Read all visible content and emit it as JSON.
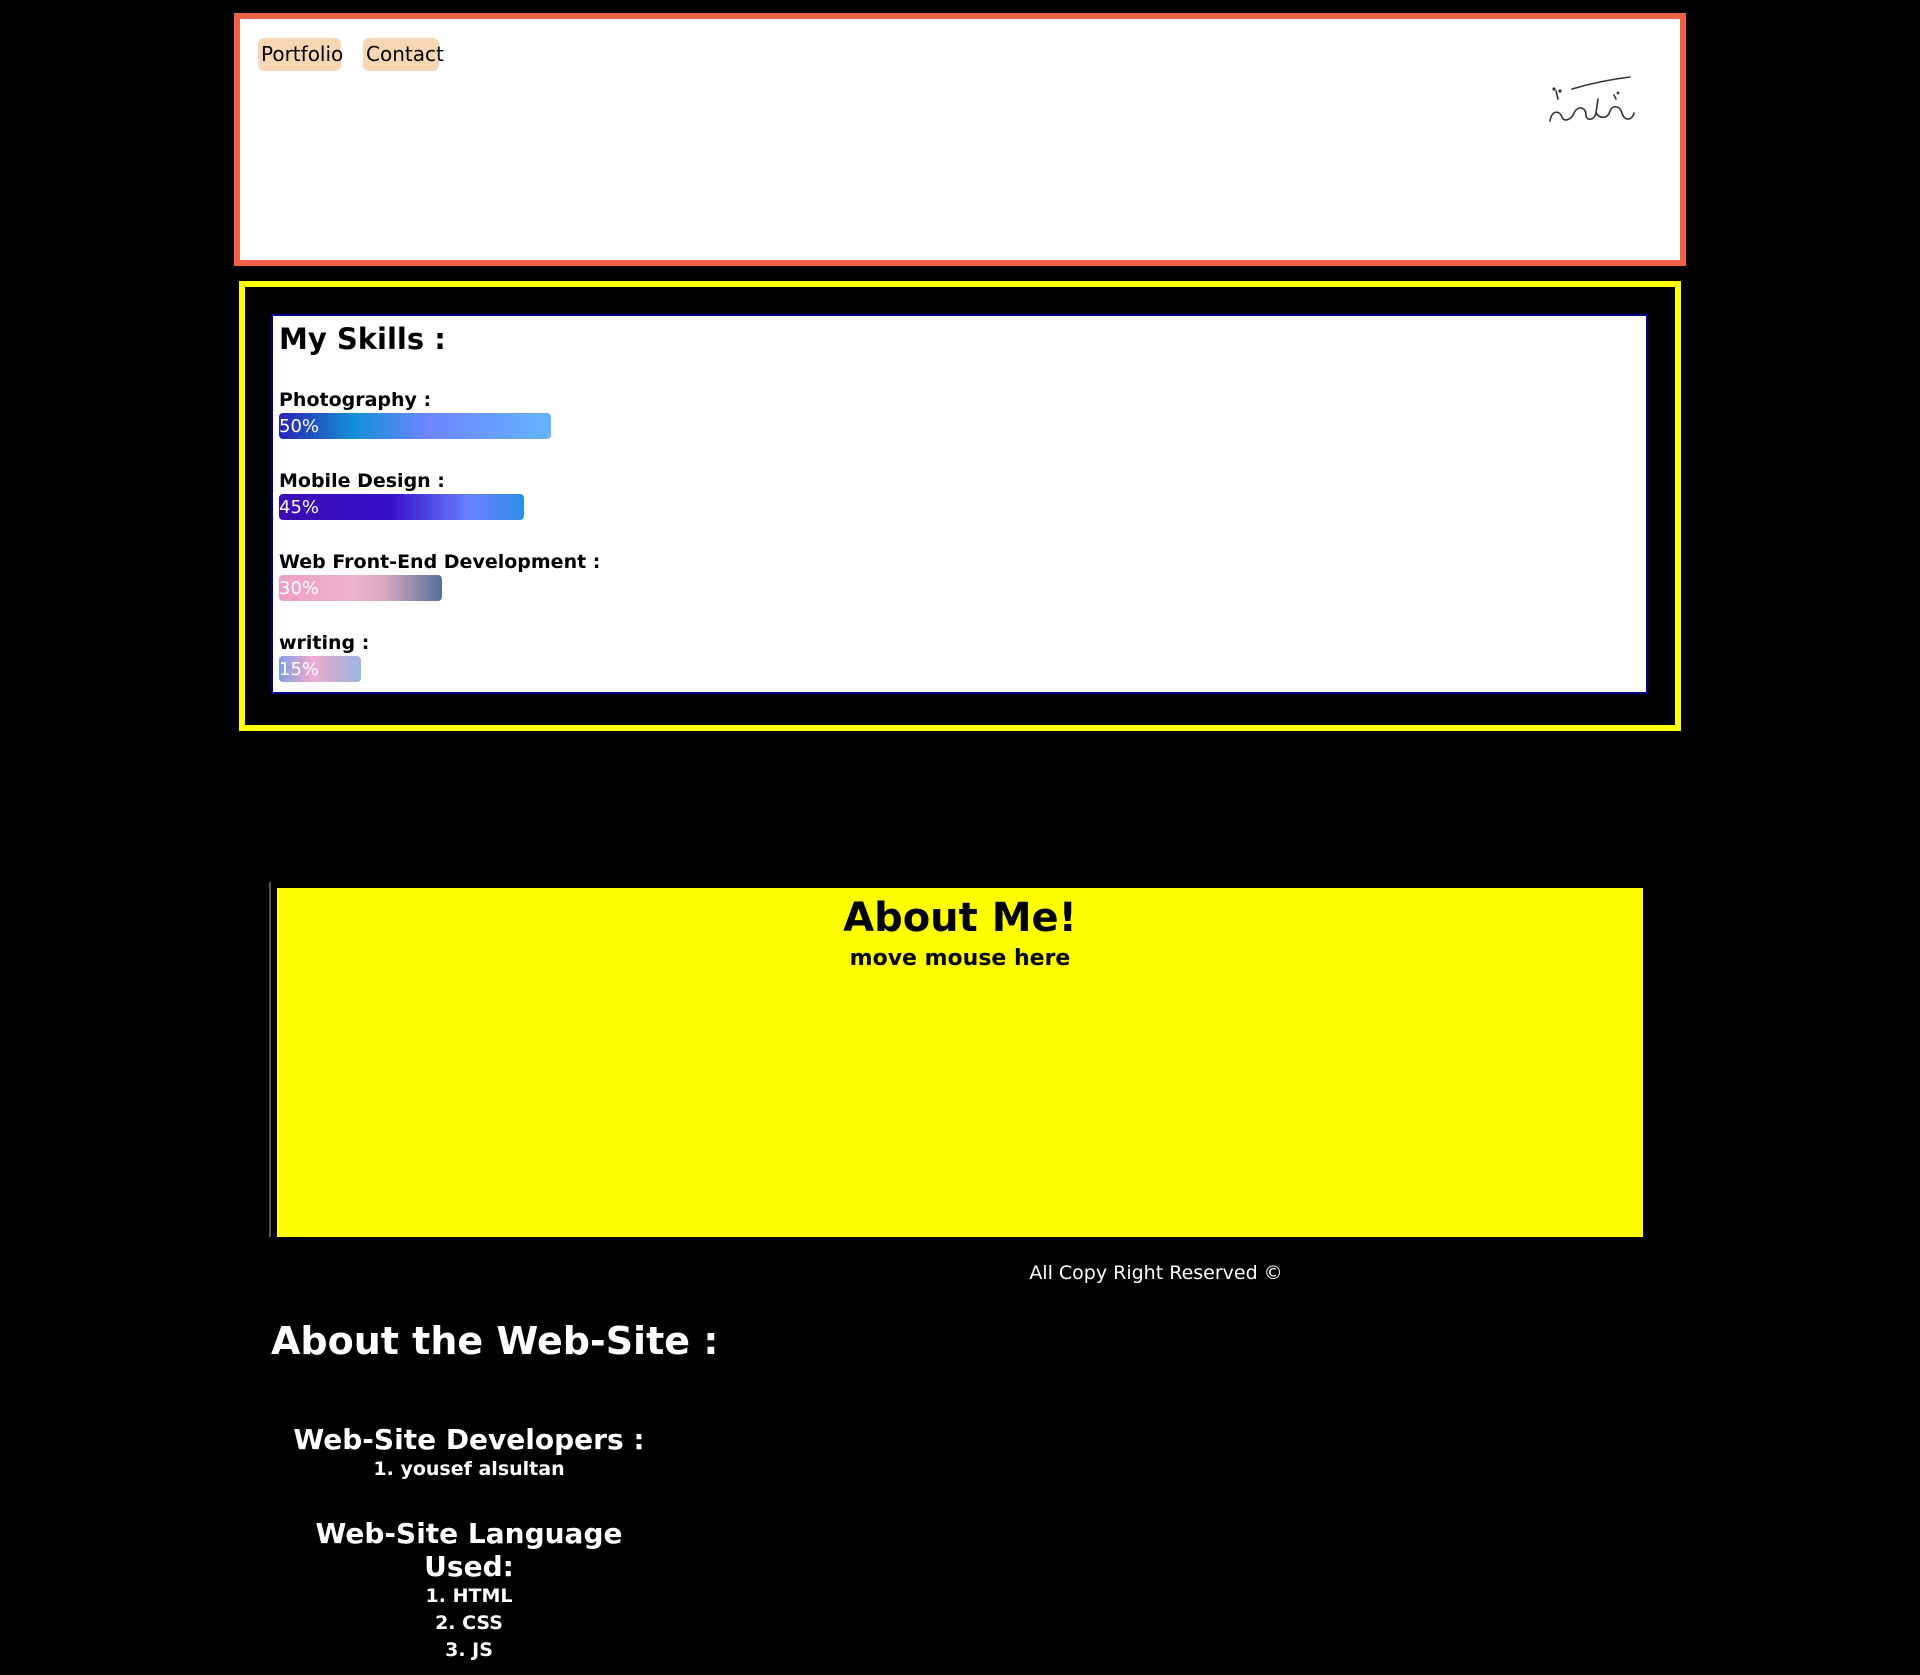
{
  "header": {
    "nav": [
      "Portfolio",
      "Contact"
    ],
    "signature_text": "يوسف عارف"
  },
  "skills": {
    "title": "My Skills :",
    "items": [
      {
        "label": "Photography :",
        "percent": "50%",
        "value": 50
      },
      {
        "label": "Mobile Design :",
        "percent": "45%",
        "value": 45
      },
      {
        "label": "Web Front-End Development :",
        "percent": "30%",
        "value": 30
      },
      {
        "label": "writing :",
        "percent": "15%",
        "value": 15
      }
    ]
  },
  "about": {
    "title": "About Me!",
    "subtitle": "move mouse here"
  },
  "footer": {
    "copyright": "All Copy Right Reserved ©"
  },
  "site_info": {
    "title": "About the Web-Site :",
    "developers_heading": "Web-Site Developers :",
    "developers": [
      "1. yousef alsultan"
    ],
    "languages_heading": "Web-Site Language Used:",
    "languages": [
      "1. HTML",
      "2. CSS",
      "3. JS"
    ]
  },
  "colors": {
    "header_border": "#f0614a",
    "skills_border": "#ffff00",
    "about_bg": "#ffff00",
    "nav_bg": "#f7d6b4"
  }
}
